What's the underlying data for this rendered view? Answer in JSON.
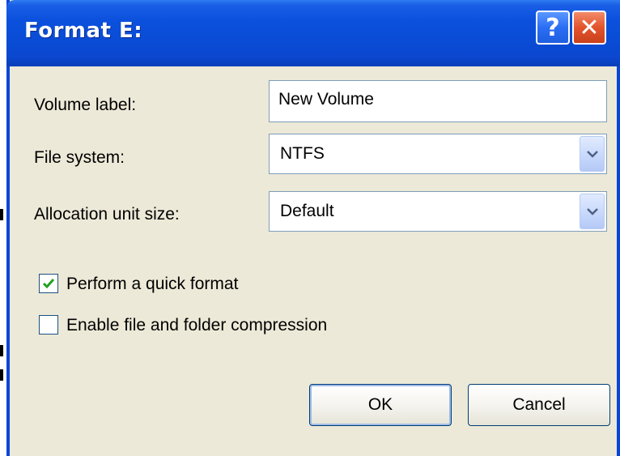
{
  "window": {
    "title": "Format E:",
    "help_glyph": "?",
    "close_glyph": "✕"
  },
  "form": {
    "volume_label": {
      "label": "Volume label:",
      "value": "New Volume"
    },
    "file_system": {
      "label": "File system:",
      "selected": "NTFS"
    },
    "allocation_unit": {
      "label": "Allocation unit size:",
      "selected": "Default"
    },
    "quick_format": {
      "label": "Perform a quick format",
      "checked": true
    },
    "compression": {
      "label": "Enable file and folder compression",
      "checked": false
    }
  },
  "buttons": {
    "ok_label": "OK",
    "cancel_label": "Cancel"
  },
  "colors": {
    "titlebar": "#0a4cd6",
    "dialog_bg": "#ece9d8",
    "close_button": "#e2542c",
    "check_mark": "#21a121"
  },
  "icons": {
    "help": "help-icon",
    "close": "close-icon",
    "dropdown": "chevron-down-icon",
    "check": "checkmark-icon"
  }
}
